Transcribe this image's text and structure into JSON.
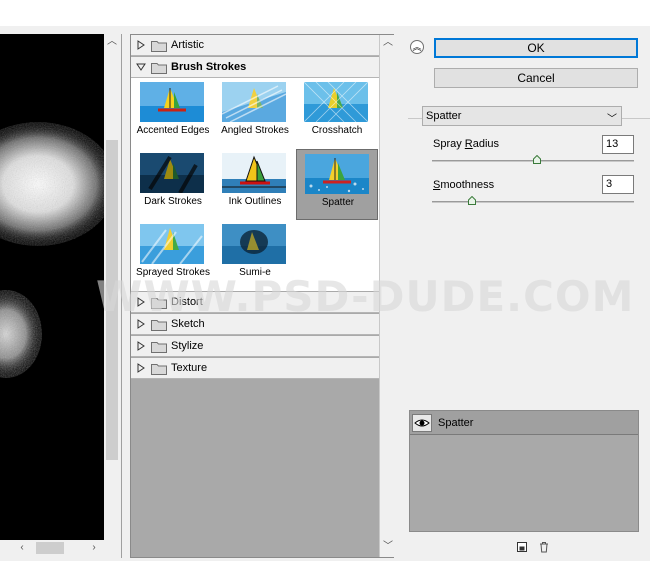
{
  "gallery": {
    "categories_top": [
      {
        "label": "Artistic",
        "open": false
      },
      {
        "label": "Brush Strokes",
        "open": true
      }
    ],
    "thumbnails": [
      {
        "label": "Accented Edges"
      },
      {
        "label": "Angled Strokes"
      },
      {
        "label": "Crosshatch"
      },
      {
        "label": "Dark Strokes"
      },
      {
        "label": "Ink Outlines"
      },
      {
        "label": "Spatter",
        "selected": true
      },
      {
        "label": "Sprayed Strokes"
      },
      {
        "label": "Sumi-e"
      }
    ],
    "categories_bottom": [
      {
        "label": "Distort"
      },
      {
        "label": "Sketch"
      },
      {
        "label": "Stylize"
      },
      {
        "label": "Texture"
      }
    ]
  },
  "buttons": {
    "ok": "OK",
    "cancel": "Cancel"
  },
  "filter_select": {
    "value": "Spatter"
  },
  "params": {
    "spray_radius": {
      "label_pre": "Spray ",
      "label_ul": "R",
      "label_post": "adius",
      "value": "13",
      "slider_fraction": 0.52
    },
    "smoothness": {
      "label_pre": "",
      "label_ul": "S",
      "label_post": "moothness",
      "value": "3",
      "slider_fraction": 0.2
    }
  },
  "layers": {
    "items": [
      {
        "name": "Spatter"
      }
    ]
  },
  "watermark": "WWW.PSD-DUDE.COM",
  "icons": {
    "collapse": "double-chevron-up-icon",
    "new_layer": "new-layer-icon",
    "delete": "trash-icon",
    "eye": "eye-icon",
    "folder": "folder-icon"
  },
  "colors": {
    "ok_border": "#0078d7",
    "gallery_bg": "#a9a9a9",
    "selection": "#a0a0a0"
  }
}
